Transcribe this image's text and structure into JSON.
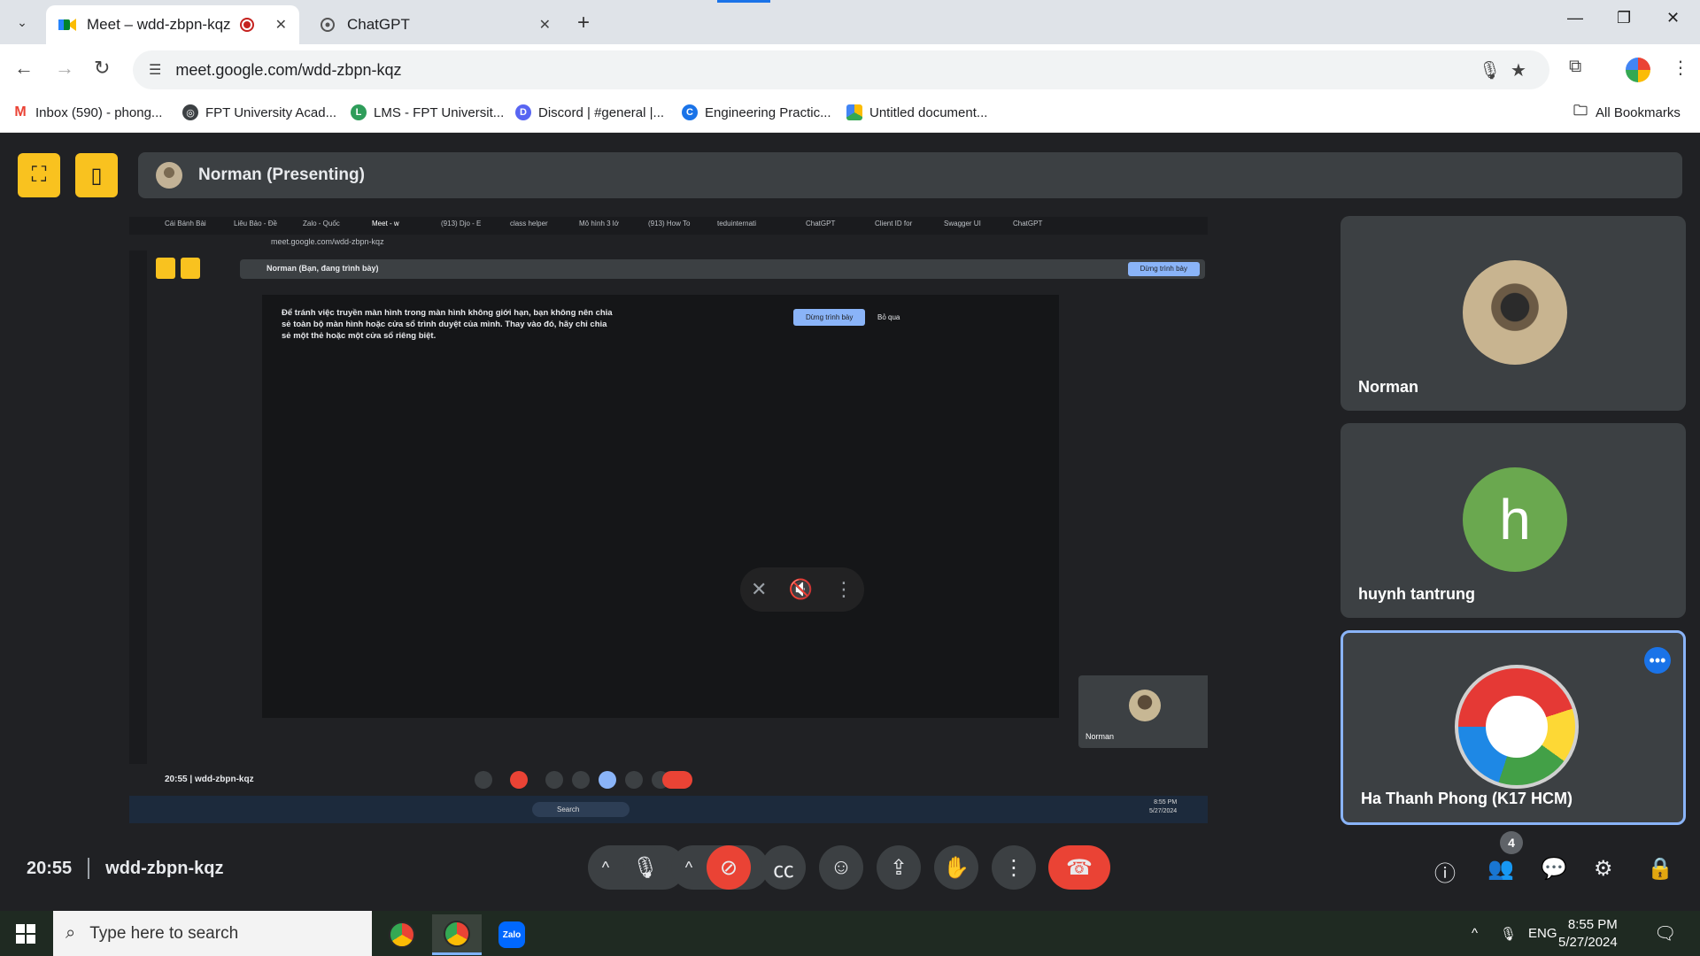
{
  "browser": {
    "tabs": [
      {
        "title": "Meet – wdd-zbpn-kqz",
        "active": true,
        "favicon": "google-meet-icon",
        "recording": true
      },
      {
        "title": "ChatGPT",
        "active": false,
        "favicon": "chatgpt-icon"
      }
    ],
    "url": "meet.google.com/wdd-zbpn-kqz",
    "bookmarks": [
      {
        "label": "Inbox (590) - phong...",
        "icon": "gmail-icon"
      },
      {
        "label": "FPT University Acad...",
        "icon": "globe-icon"
      },
      {
        "label": "LMS - FPT Universit...",
        "icon": "lms-icon"
      },
      {
        "label": "Discord | #general |...",
        "icon": "discord-icon"
      },
      {
        "label": "Engineering Practic...",
        "icon": "engineering-icon"
      },
      {
        "label": "Untitled document...",
        "icon": "google-drive-icon"
      }
    ],
    "all_bookmarks": "All Bookmarks"
  },
  "meet": {
    "presenter": "Norman (Presenting)",
    "meeting_time": "20:55",
    "meeting_code": "wdd-zbpn-kqz",
    "participant_count": "4",
    "participants": [
      {
        "name": "Norman",
        "avatar": "cat-photo"
      },
      {
        "name": "huynh tantrung",
        "initial": "h",
        "color": "#6aa84f"
      },
      {
        "name": "Ha Thanh Phong (K17 HCM)",
        "avatar": "unicorn-photo",
        "speaking": true
      }
    ],
    "shared_screen": {
      "inner_tabs": [
        "Cái Bánh Bài",
        "Liêu Bảo - Đề",
        "Zalo - Quốc",
        "Meet - w",
        "(913) Djo - E",
        "class helper",
        "Mô hình 3 lớ",
        "(913) How To",
        "teduinternati",
        "ChatGPT",
        "Client ID for",
        "Swagger UI",
        "ChatGPT"
      ],
      "inner_url": "meet.google.com/wdd-zbpn-kqz",
      "inner_presenter": "Norman (Bạn, đang trình bày)",
      "inner_stop": "Dừng trình bày",
      "warning": "Để tránh việc truyền màn hình trong màn hình không giới hạn, bạn không nên chia sẻ toàn bộ màn hình hoặc cửa sổ trình duyệt của mình. Thay vào đó, hãy chỉ chia sẻ một thẻ hoặc một cửa sổ riêng biệt.",
      "stop_button": "Dừng trình bày",
      "skip_button": "Bỏ qua",
      "mini_tile_name": "Norman",
      "inner_time": "20:55",
      "inner_code": "wdd-zbpn-kqz",
      "inner_search": "Search",
      "inner_clock_time": "8:55 PM",
      "inner_clock_date": "5/27/2024"
    }
  },
  "taskbar": {
    "search_placeholder": "Type here to search",
    "language": "ENG",
    "time": "8:55 PM",
    "date": "5/27/2024",
    "zalo_label": "Zalo"
  }
}
